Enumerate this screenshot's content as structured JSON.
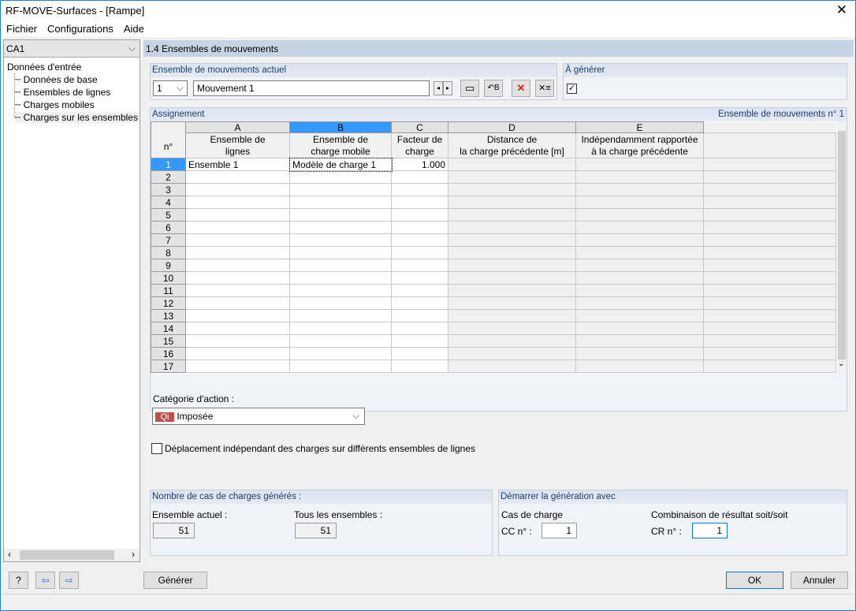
{
  "window": {
    "title": "RF-MOVE-Surfaces - [Rampe]",
    "close": "✕"
  },
  "menu": [
    "Fichier",
    "Configurations",
    "Aide"
  ],
  "sidebar": {
    "combo": "CA1",
    "root": "Données d'entrée",
    "items": [
      "Données de base",
      "Ensembles de lignes",
      "Charges mobiles",
      "Charges sur les ensembles de lignes"
    ]
  },
  "section_title": "1.4 Ensembles de mouvements",
  "current_set": {
    "label": "Ensemble de mouvements actuel",
    "number": "1",
    "name": "Mouvement 1"
  },
  "generate": {
    "label": "À générer",
    "checked": true
  },
  "assignment": {
    "label": "Assignement",
    "right_label": "Ensemble de mouvements n° 1",
    "row_header": "n°",
    "columns": [
      {
        "letter": "A",
        "l1": "Ensemble de",
        "l2": "lignes"
      },
      {
        "letter": "B",
        "l1": "Ensemble de",
        "l2": "charge mobile"
      },
      {
        "letter": "C",
        "l1": "Facteur de",
        "l2": "charge"
      },
      {
        "letter": "D",
        "l1": "Distance de",
        "l2": "la charge précédente [m]"
      },
      {
        "letter": "E",
        "l1": "Indépendamment rapportée",
        "l2": "à la charge précédente"
      }
    ],
    "rows": [
      {
        "n": "1",
        "a": "Ensemble 1",
        "b": "Modèle de charge 1",
        "c": "1.000",
        "d": "",
        "e": ""
      },
      {
        "n": "2"
      },
      {
        "n": "3"
      },
      {
        "n": "4"
      },
      {
        "n": "5"
      },
      {
        "n": "6"
      },
      {
        "n": "7"
      },
      {
        "n": "8"
      },
      {
        "n": "9"
      },
      {
        "n": "10"
      },
      {
        "n": "11"
      },
      {
        "n": "12"
      },
      {
        "n": "13"
      },
      {
        "n": "14"
      },
      {
        "n": "15"
      },
      {
        "n": "16"
      },
      {
        "n": "17"
      }
    ]
  },
  "action_category": {
    "label": "Catégorie d'action :",
    "badge": "Qi",
    "value": "Imposée",
    "badge_color": "#c0504d"
  },
  "independent": {
    "label": "Déplacement indépendant des charges sur différents ensembles de lignes",
    "checked": false
  },
  "count": {
    "label": "Nombre de cas de charges générés :",
    "current_label": "Ensemble actuel :",
    "current": "51",
    "all_label": "Tous les ensembles :",
    "all": "51"
  },
  "start": {
    "label": "Démarrer la génération avec",
    "lc_label": "Cas de charge",
    "lc_prefix": "CC n° :",
    "lc": "1",
    "rc_label": "Combinaison de résultat soit/soit",
    "rc_prefix": "CR n° :",
    "rc": "1"
  },
  "buttons": {
    "generate": "Générer",
    "ok": "OK",
    "cancel": "Annuler"
  },
  "colors": {
    "accent": "#3399ff",
    "header_bg": "#c5d3e2"
  }
}
